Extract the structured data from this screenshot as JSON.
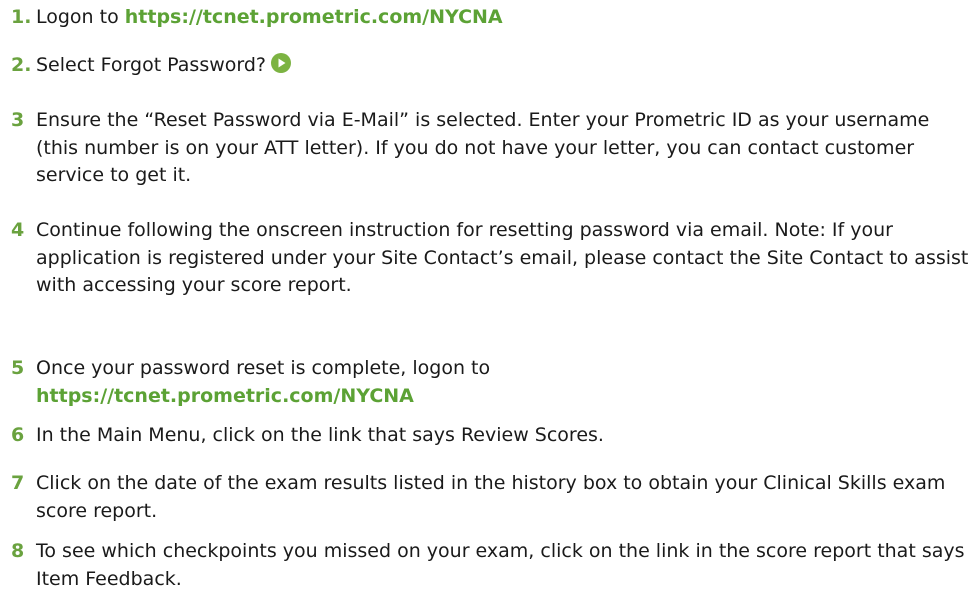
{
  "colors": {
    "number": "#6aa23f",
    "link": "#5ca235",
    "text": "#1a1a1a",
    "play_icon": "#7cb342"
  },
  "steps": [
    {
      "num": "1.",
      "pre": "Logon to ",
      "link": "https://tcnet.prometric.com/NYCNA"
    },
    {
      "num": "2.",
      "text": "Select Forgot Password?",
      "icon": "play-circle-icon"
    },
    {
      "num": "3",
      "text": "Ensure the “Reset Password via E-Mail” is selected. Enter your Prometric ID as your username (this number is on your ATT letter). If you do not have your letter, you can contact customer service to get it."
    },
    {
      "num": "4",
      "text": "Continue following the onscreen instruction for resetting password via email. Note: If your application is registered under your Site Contact’s email, please contact the Site Contact to assist with accessing your score report."
    },
    {
      "num": "5",
      "pre": "Once your password reset is complete, logon to",
      "link": "https://tcnet.prometric.com/NYCNA"
    },
    {
      "num": "6",
      "text": "In the Main Menu, click on the link that says Review Scores."
    },
    {
      "num": "7",
      "text": "Click on the date of the exam results listed in the history box to obtain your Clinical Skills exam score report."
    },
    {
      "num": "8",
      "text": "To see which checkpoints you missed on your exam, click on the link in the score report that says Item Feedback."
    }
  ]
}
